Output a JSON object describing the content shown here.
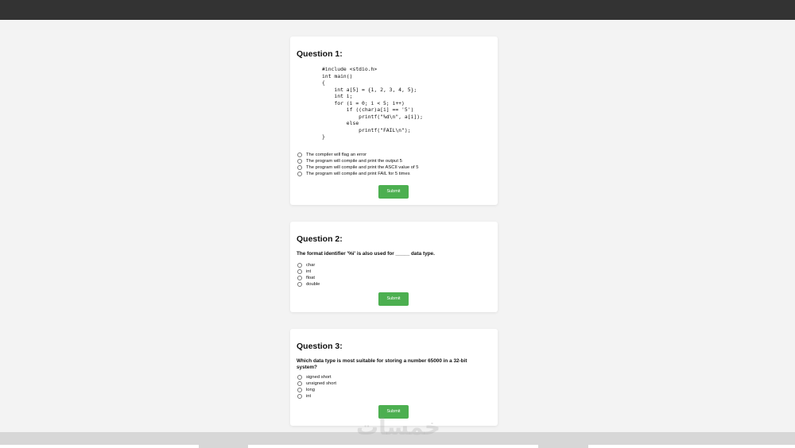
{
  "questions": [
    {
      "title": "Question 1:",
      "code": "#include <stdio.h>\nint main()\n{\n    int a[5] = {1, 2, 3, 4, 5};\n    int i;\n    for (i = 0; i < 5; i++)\n        if ((char)a[i] == '5')\n            printf(\"%d\\n\", a[i]);\n        else\n            printf(\"FAIL\\n\");\n}",
      "options": [
        "The compiler will flag an error",
        "The program will compile and print the output 5",
        "The program will compile and print the ASCII value of 5",
        "The program will compile and print FAIL for 5 times"
      ],
      "submit_label": "Submit"
    },
    {
      "title": "Question 2:",
      "text": "The format identifier '%i' is also used for _____ data type.",
      "options": [
        "char",
        "int",
        "float",
        "double"
      ],
      "submit_label": "Submit"
    },
    {
      "title": "Question 3:",
      "text": "Which data type is most suitable for storing a number 65000 in a 32-bit system?",
      "options": [
        "signed short",
        "unsigned short",
        "long",
        "int"
      ],
      "submit_label": "Submit"
    }
  ],
  "watermark": "خمسات",
  "colors": {
    "topbar": "#333333",
    "background": "#f3f3f3",
    "card": "#ffffff",
    "submit": "#4caf50"
  }
}
